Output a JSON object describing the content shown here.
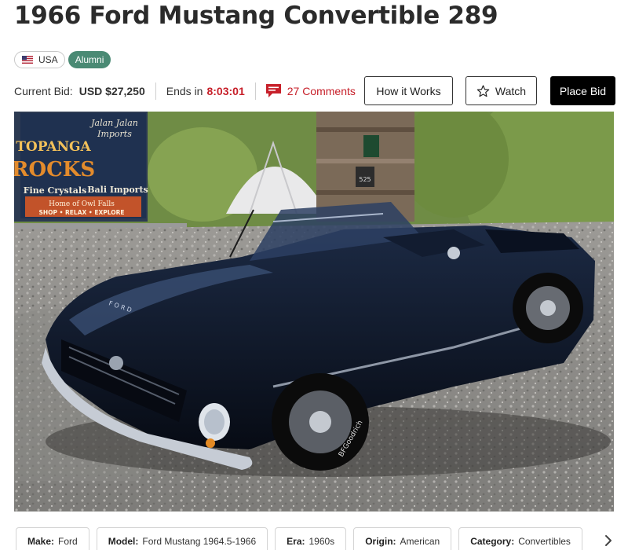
{
  "listing": {
    "title": "1966 Ford Mustang Convertible 289"
  },
  "badges": {
    "country": "USA",
    "alumni": "Alumni"
  },
  "bid": {
    "current_label": "Current Bid:",
    "current_value": "USD $27,250",
    "ends_label": "Ends in",
    "ends_time": "8:03:01",
    "comments": "27 Comments"
  },
  "actions": {
    "how": "How it Works",
    "watch": "Watch",
    "place_bid": "Place Bid"
  },
  "photo": {
    "signs": {
      "jalan": "Jalan Jalan",
      "imports": "Imports",
      "topanga": "TOPANGA",
      "rocks": "ROCKS",
      "crystals": "Fine Crystals",
      "bali": "Bali Imports",
      "owl": "Home of Owl Falls",
      "shop": "SHOP • RELAX • EXPLORE",
      "number": "525"
    },
    "car": {
      "hood_letters": "F O R D",
      "tire": "BFGoodrich"
    }
  },
  "specs": [
    {
      "key": "Make:",
      "value": "Ford"
    },
    {
      "key": "Model:",
      "value": "Ford Mustang 1964.5-1966"
    },
    {
      "key": "Era:",
      "value": "1960s"
    },
    {
      "key": "Origin:",
      "value": "American"
    },
    {
      "key": "Category:",
      "value": "Convertibles"
    }
  ],
  "colors": {
    "accent_red": "#c7202a",
    "alumni_green": "#4a8a74",
    "car_body": "#0d1526"
  }
}
